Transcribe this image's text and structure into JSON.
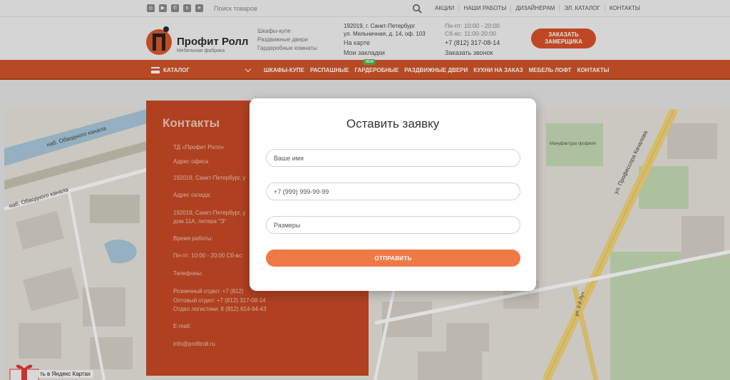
{
  "topbar": {
    "social_icons": [
      "instagram-icon",
      "youtube-icon",
      "whatsapp-icon",
      "vk-icon",
      "telegram-icon"
    ],
    "search_placeholder": "Поиск товаров",
    "links": [
      "АКЦИИ",
      "НАШИ РАБОТЫ",
      "ДИЗАЙНЕРАМ",
      "ЭЛ. КАТАЛОГ",
      "КОНТАКТЫ"
    ]
  },
  "header": {
    "logo_name": "Профит Ролл",
    "logo_sub": "Мебельная фабрика",
    "categories": [
      "Шкафы-купе",
      "Раздвижные двери",
      "Гардеробные комнаты"
    ],
    "address_line1": "192019, г. Санкт-Петербург",
    "address_line2": "ул. Мельничная, д. 14, оф. 103",
    "map_link": "На карте",
    "bookmarks_link": "Мои закладки",
    "hours_weekdays": "Пн-пт: 10:00 - 20:00",
    "hours_saturday": "Сб-вс: 11:00-20:00",
    "phone": "+7 (812) 317-08-14",
    "callback": "Заказать звонок",
    "order_button_line1": "ЗАКАЗАТЬ",
    "order_button_line2": "ЗАМЕРЩИКА"
  },
  "nav": {
    "catalog_label": "КАТАЛОГ",
    "items": [
      "ШКАФЫ-КУПЕ",
      "РАСПАШНЫЕ",
      "ГАРДЕРОБНЫЕ",
      "РАЗДВИЖНЫЕ ДВЕРИ",
      "КУХНИ НА ЗАКАЗ",
      "МЕБЕЛЬ ЛОФТ",
      "КОНТАКТЫ"
    ],
    "new_badge": "NEW"
  },
  "contacts": {
    "title": "Контакты",
    "lines": [
      "ТД «Профит Ролл»",
      "Адрес офиса",
      "192019, Санкт-Петербург, у",
      "Адрес склада:",
      "192019, Санкт-Петербург, у",
      "дом 11А, литера \"Э\"",
      "Время работы:",
      "Пн-пт: 10:00 - 20:00 Сб-вс:",
      "Телефоны:",
      "Розничный отдел: +7 (812)",
      "Оптовый отдел: +7 (812) 317-08-14",
      "Отдел логистики: 8 (812) 614-64-43",
      "E-mail:",
      "info@profitroll.ru"
    ]
  },
  "map": {
    "streets": [
      "наб. Обводного канала",
      "наб. Обводного канала",
      "ул. Профессора Качалова",
      "Мануфактура профиля",
      "ул. 2-й Луч"
    ],
    "badge": "ть в Яндекс Картах"
  },
  "modal": {
    "title": "Оставить заявку",
    "name_placeholder": "Ваше имя",
    "phone_placeholder": "+7 (999) 999-99-99",
    "sizes_placeholder": "Размеры",
    "submit_label": "ОТПРАВИТЬ"
  },
  "colors": {
    "brand": "#d15528",
    "panel": "#c84a26",
    "submit": "#f07a46"
  }
}
